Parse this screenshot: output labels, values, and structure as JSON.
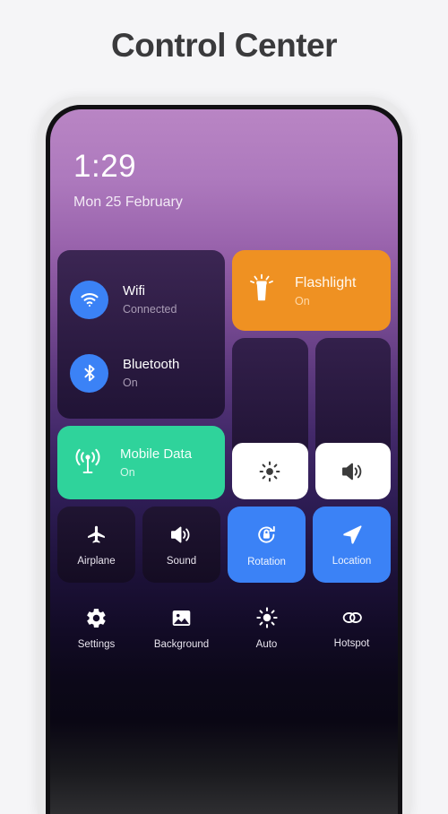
{
  "page": {
    "title": "Control Center"
  },
  "status": {
    "time": "1:29",
    "date": "Mon 25 February"
  },
  "colors": {
    "accent_blue": "#3b82f6",
    "flashlight_orange": "#ef9122",
    "mobile_data_green": "#2fd39b",
    "tile_dark": "#2a1a45",
    "slider_fill": "#ffffff",
    "title_text": "#3a3a3c"
  },
  "connectivity": {
    "wifi": {
      "label": "Wifi",
      "status": "Connected",
      "icon": "wifi-icon",
      "state": "on"
    },
    "bluetooth": {
      "label": "Bluetooth",
      "status": "On",
      "icon": "bluetooth-icon",
      "state": "on"
    }
  },
  "mobile_data": {
    "label": "Mobile Data",
    "status": "On",
    "icon": "cell-signal-icon",
    "state": "on"
  },
  "flashlight": {
    "label": "Flashlight",
    "status": "On",
    "icon": "flashlight-icon",
    "state": "on"
  },
  "sliders": [
    {
      "name": "brightness",
      "icon": "brightness-sun-icon",
      "value": 35
    },
    {
      "name": "volume",
      "icon": "volume-speaker-icon",
      "value": 35
    }
  ],
  "toggles_row_1": [
    {
      "label": "Airplane",
      "icon": "airplane-icon",
      "state": "off"
    },
    {
      "label": "Sound",
      "icon": "sound-speaker-icon",
      "state": "off"
    },
    {
      "label": "Rotation",
      "icon": "rotation-lock-icon",
      "state": "on"
    },
    {
      "label": "Location",
      "icon": "location-arrow-icon",
      "state": "on"
    }
  ],
  "toggles_row_2": [
    {
      "label": "Settings",
      "icon": "gear-icon",
      "state": "off"
    },
    {
      "label": "Background",
      "icon": "image-icon",
      "state": "off"
    },
    {
      "label": "Auto",
      "icon": "auto-brightness-icon",
      "state": "off"
    },
    {
      "label": "Hotspot",
      "icon": "hotspot-rings-icon",
      "state": "off"
    }
  ]
}
